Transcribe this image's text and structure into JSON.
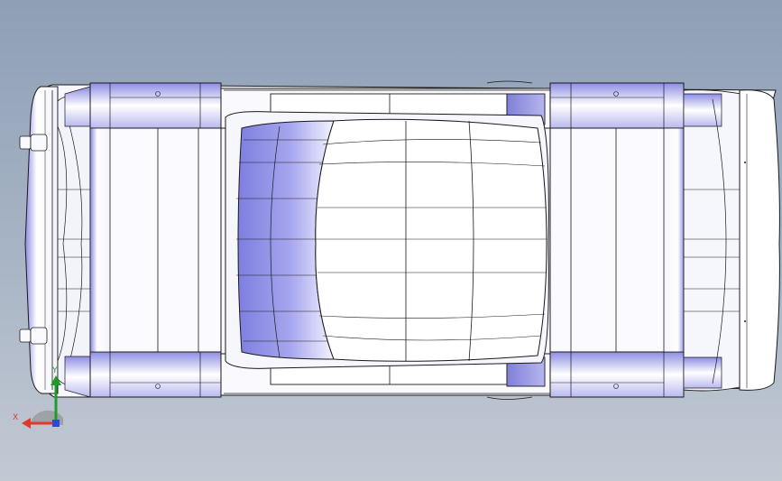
{
  "viewport": {
    "background_top": "#8e9fb6",
    "background_bottom": "#c2c9d3"
  },
  "model": {
    "view": "top",
    "edge_color": "#1a1a1a",
    "face_light": "#ffffff",
    "face_shade": "#8f8fe6"
  },
  "triad": {
    "x_label": "X",
    "y_label": "Y",
    "x_color": "#e03a2a",
    "y_color": "#1f9a2c",
    "z_color": "#2a4cd0"
  }
}
